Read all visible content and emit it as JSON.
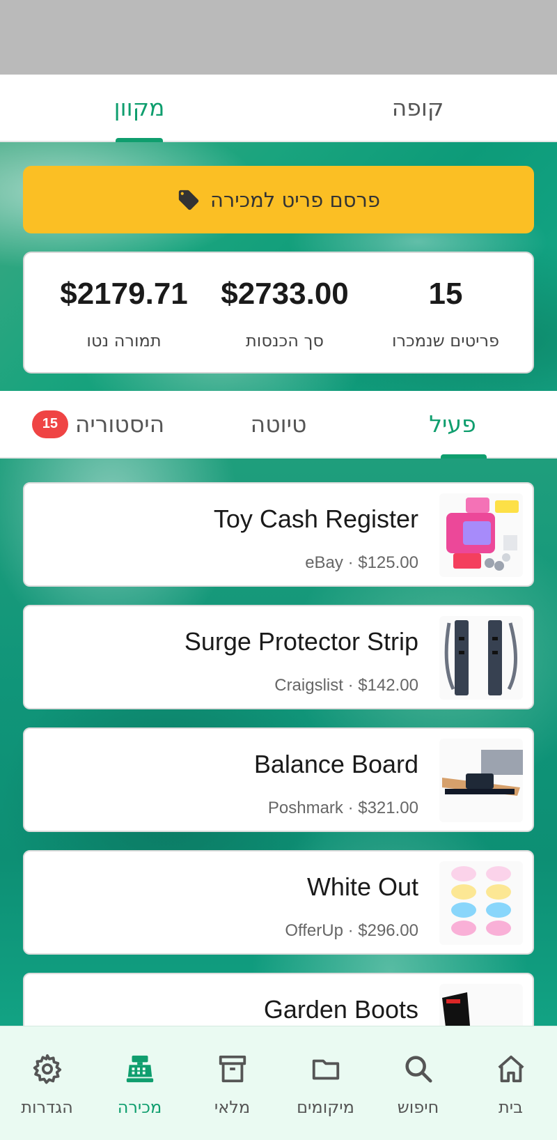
{
  "top_tabs": [
    {
      "label": "קופה",
      "active": false
    },
    {
      "label": "מקוון",
      "active": true
    }
  ],
  "post_button": {
    "label": "פרסם פריט למכירה",
    "icon": "tag-icon"
  },
  "stats": [
    {
      "value": "15",
      "label": "פריטים שנמכרו"
    },
    {
      "value": "$2733.00",
      "label": "סך הכנסות"
    },
    {
      "value": "$2179.71",
      "label": "תמורה נטו"
    }
  ],
  "sub_tabs": [
    {
      "label": "פעיל",
      "active": true
    },
    {
      "label": "טיוטה",
      "active": false
    },
    {
      "label": "היסטוריה",
      "active": false,
      "badge": "15"
    }
  ],
  "items": [
    {
      "name": "Toy Cash Register",
      "meta": "eBay · $125.00"
    },
    {
      "name": "Surge Protector Strip",
      "meta": "Craigslist · $142.00"
    },
    {
      "name": "Balance Board",
      "meta": "Poshmark · $321.00"
    },
    {
      "name": "White Out",
      "meta": "OfferUp · $296.00"
    },
    {
      "name": "Garden Boots",
      "meta": ""
    }
  ],
  "bottom_nav": [
    {
      "label": "בית",
      "icon": "home-icon"
    },
    {
      "label": "חיפוש",
      "icon": "search-icon"
    },
    {
      "label": "מיקומים",
      "icon": "folder-icon"
    },
    {
      "label": "מלאי",
      "icon": "archive-icon"
    },
    {
      "label": "מכירה",
      "icon": "cash-register-icon",
      "active": true
    },
    {
      "label": "הגדרות",
      "icon": "gear-icon"
    }
  ],
  "colors": {
    "accent": "#0f9e6e",
    "button": "#fbbf24",
    "badge": "#ef4444"
  }
}
